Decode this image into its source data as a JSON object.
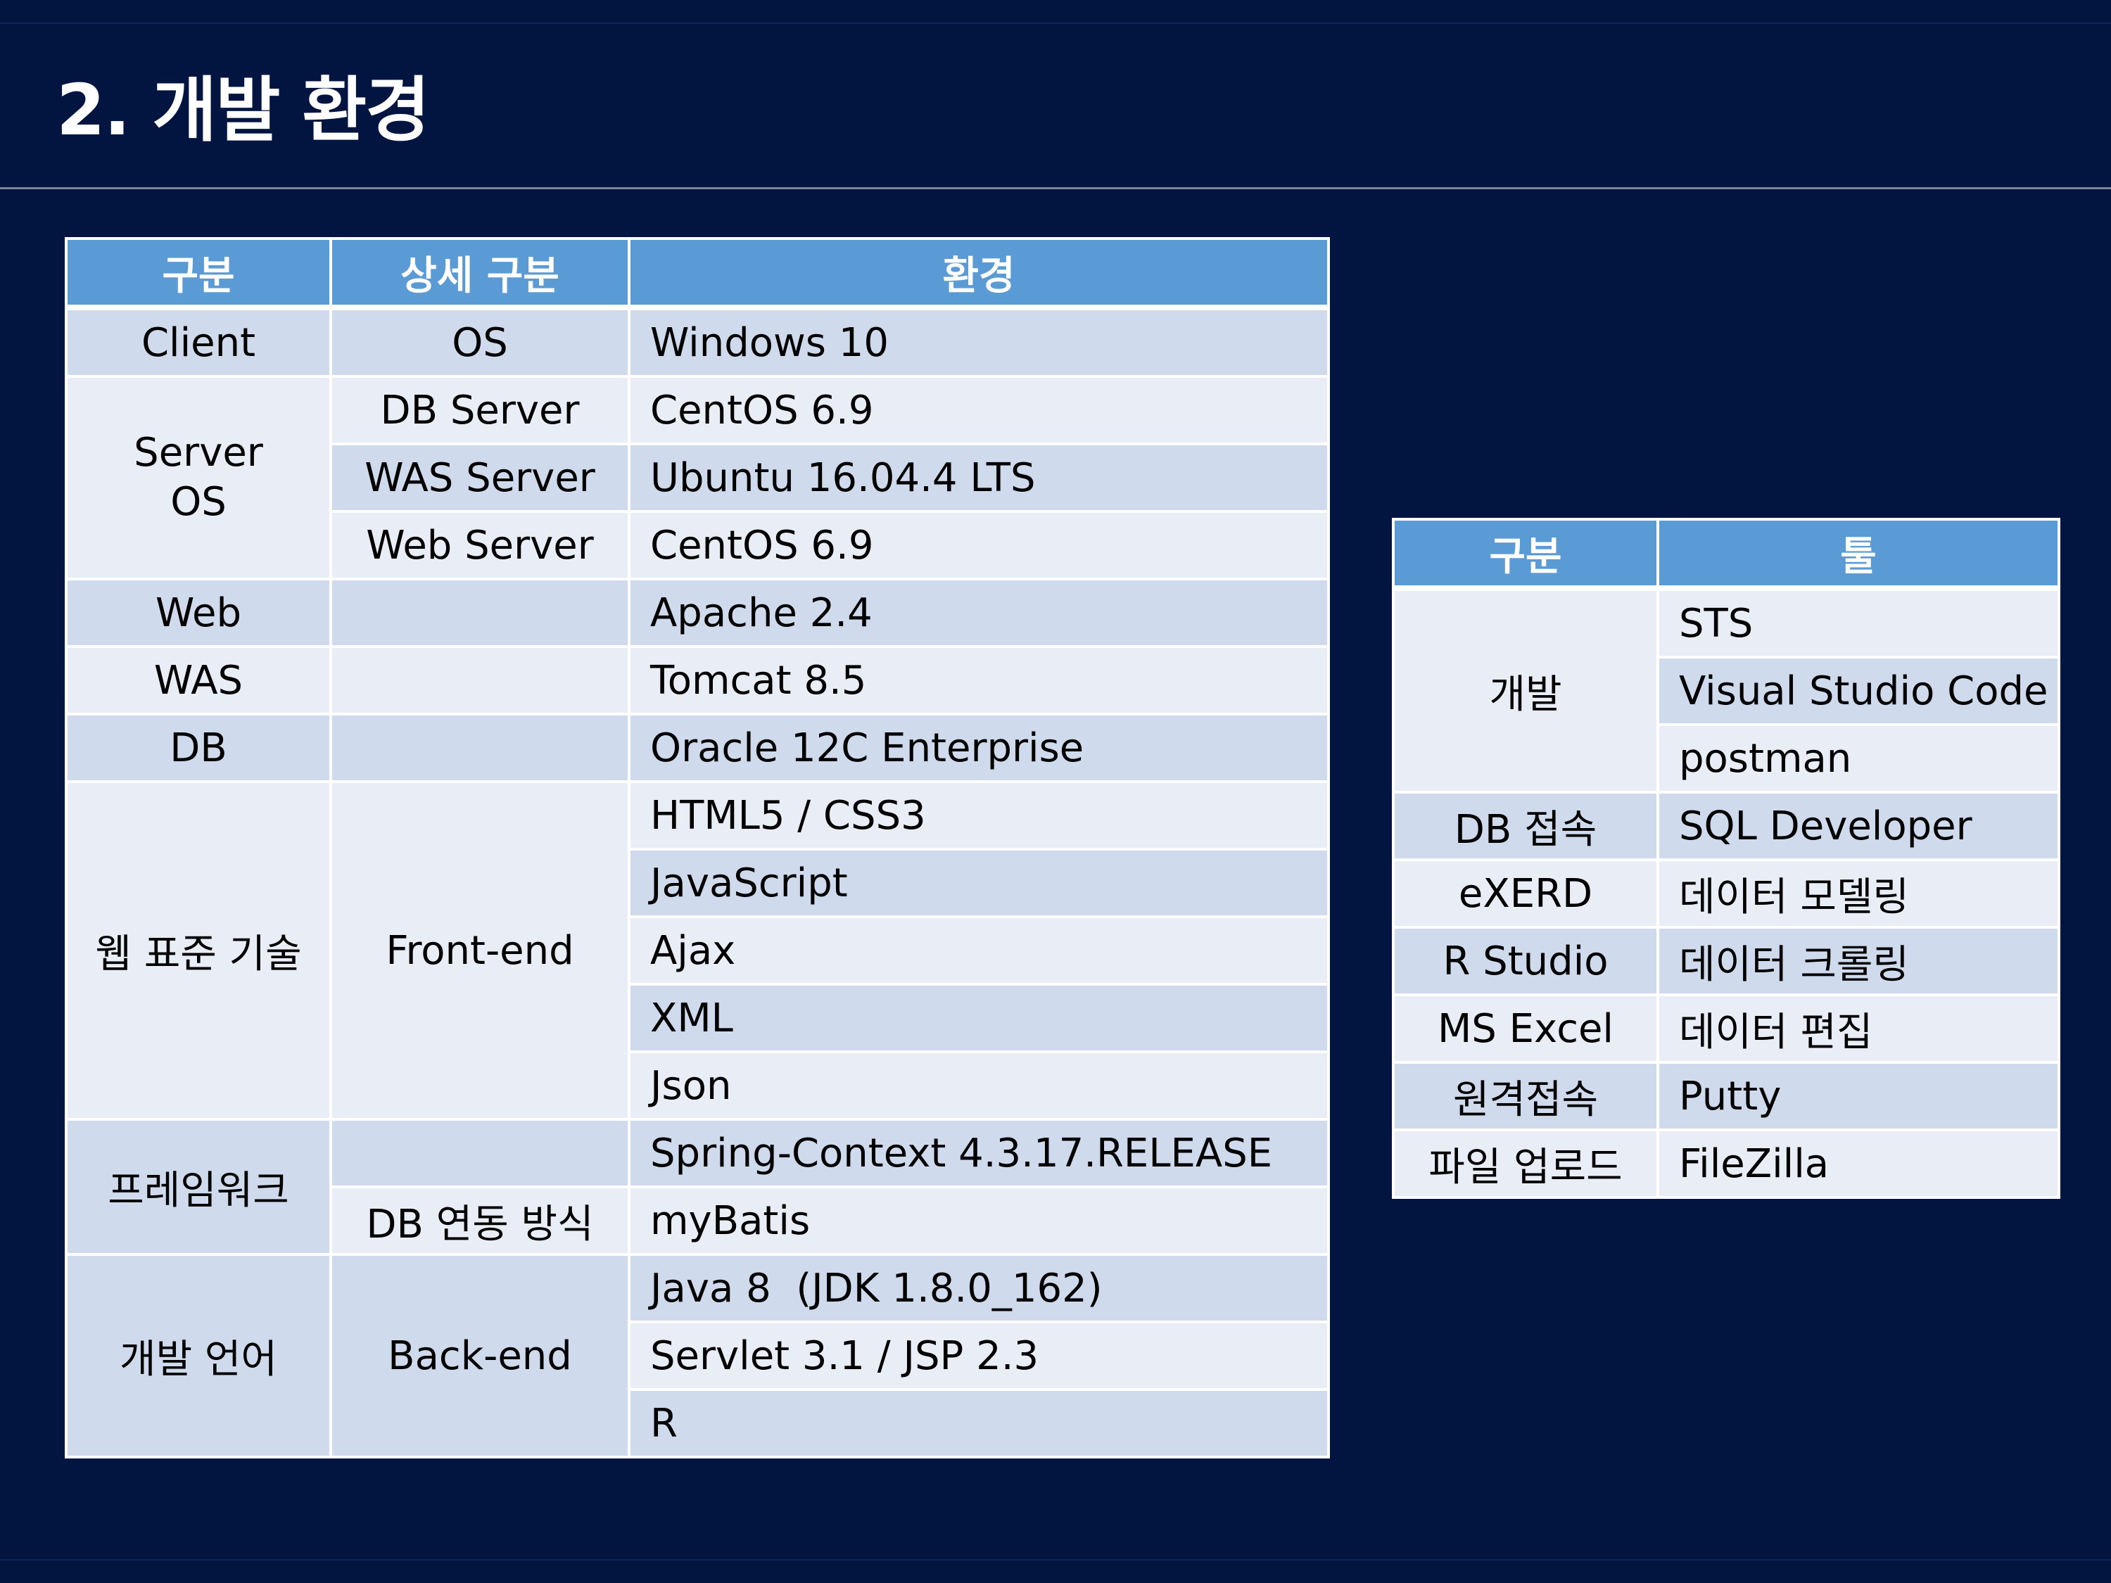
{
  "title": "2. 개발 환경",
  "env_table": {
    "headers": [
      "구분",
      "상세 구분",
      "환경"
    ],
    "rows": [
      {
        "category": "Client",
        "detail": "OS",
        "env": "Windows 10"
      },
      {
        "category": "Server\nOS",
        "detail": "DB Server",
        "env": "CentOS 6.9"
      },
      {
        "category": "",
        "detail": "WAS Server",
        "env": "Ubuntu 16.04.4 LTS"
      },
      {
        "category": "",
        "detail": "Web Server",
        "env": "CentOS 6.9"
      },
      {
        "category": "Web",
        "detail": "",
        "env": "Apache 2.4"
      },
      {
        "category": "WAS",
        "detail": "",
        "env": "Tomcat 8.5"
      },
      {
        "category": "DB",
        "detail": "",
        "env": "Oracle 12C Enterprise"
      },
      {
        "category": "웹 표준 기술",
        "detail": "Front-end",
        "env": "HTML5 / CSS3"
      },
      {
        "category": "",
        "detail": "",
        "env": "JavaScript"
      },
      {
        "category": "",
        "detail": "",
        "env": "Ajax"
      },
      {
        "category": "",
        "detail": "",
        "env": "XML"
      },
      {
        "category": "",
        "detail": "",
        "env": "Json"
      },
      {
        "category": "프레임워크",
        "detail": "",
        "env": "Spring-Context 4.3.17.RELEASE"
      },
      {
        "category": "",
        "detail": "DB 연동 방식",
        "env": "myBatis"
      },
      {
        "category": "개발 언어",
        "detail": "Back-end",
        "env": "Java 8  (JDK 1.8.0_162)"
      },
      {
        "category": "",
        "detail": "",
        "env": "Servlet 3.1 / JSP 2.3"
      },
      {
        "category": "",
        "detail": "",
        "env": "R"
      }
    ]
  },
  "tool_table": {
    "headers": [
      "구분",
      "툴"
    ],
    "rows": [
      {
        "category": "개발",
        "tool": "STS"
      },
      {
        "category": "",
        "tool": "Visual Studio Code"
      },
      {
        "category": "",
        "tool": "postman"
      },
      {
        "category": "DB 접속",
        "tool": "SQL Developer"
      },
      {
        "category": "eXERD",
        "tool": "데이터 모델링"
      },
      {
        "category": "R Studio",
        "tool": "데이터 크롤링"
      },
      {
        "category": "MS Excel",
        "tool": "데이터 편집"
      },
      {
        "category": "원격접속",
        "tool": "Putty"
      },
      {
        "category": "파일 업로드",
        "tool": "FileZilla"
      }
    ]
  },
  "colors": {
    "background": "#021540",
    "header": "#5b9bd5",
    "row_dark": "#cfdaec",
    "row_light": "#e8edf6"
  }
}
